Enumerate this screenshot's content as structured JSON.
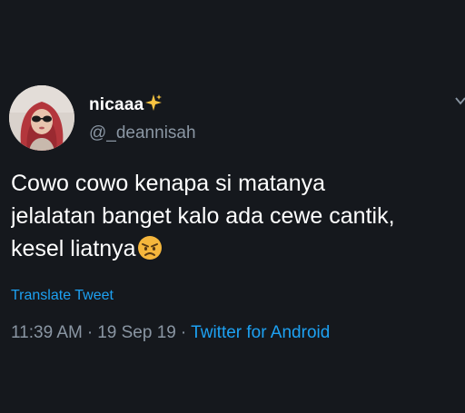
{
  "user": {
    "display_name": "nicaaa",
    "handle": "@_deannisah",
    "name_emoji": "sparkles-icon"
  },
  "tweet": {
    "lines": [
      "Cowo cowo kenapa si matanya",
      "jelalatan banget kalo ada cewe cantik,",
      "kesel liatnya"
    ],
    "trailing_emoji": "angry-face-icon"
  },
  "actions": {
    "translate_label": "Translate Tweet"
  },
  "meta": {
    "time": "11:39 AM",
    "separator": "·",
    "date": "19 Sep 19",
    "source": "Twitter for Android"
  },
  "colors": {
    "background": "#15181d",
    "text_primary": "#ffffff",
    "text_secondary": "#8a96a3",
    "accent": "#1da1f2"
  }
}
